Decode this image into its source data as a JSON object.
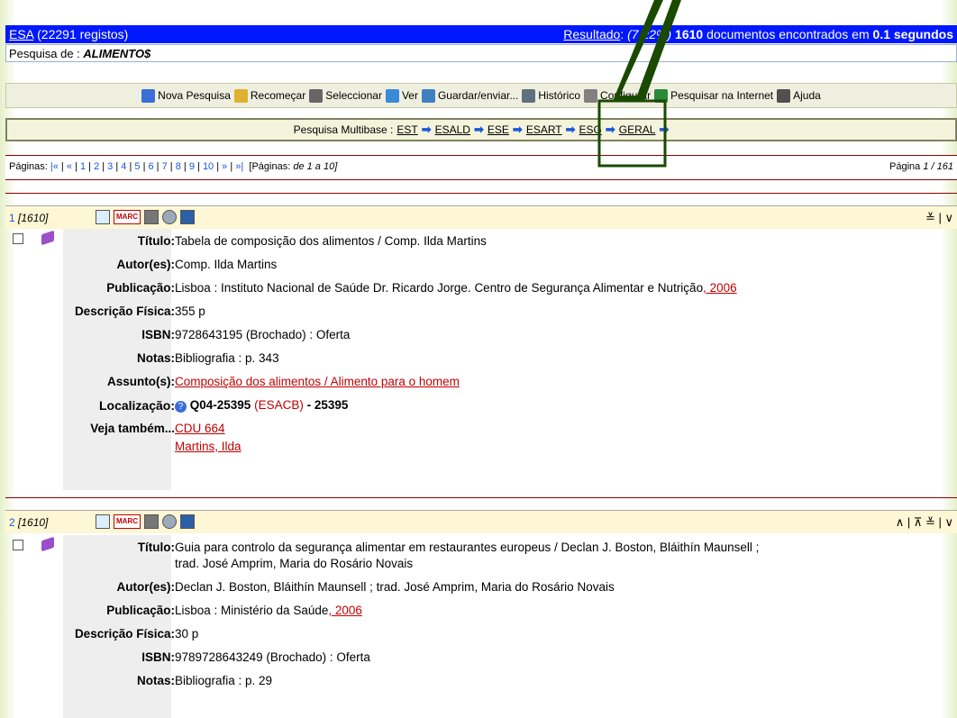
{
  "header": {
    "db_name": "ESA",
    "db_count": "(22291 registos)",
    "result_label": "Resultado",
    "result_pct": "(7.22%)",
    "result_count": "1610",
    "result_text": "documentos encontrados em",
    "result_time": "0.1 segundos"
  },
  "query": {
    "label": "Pesquisa de :",
    "term": "ALIMENTO$"
  },
  "toolbar": {
    "items": [
      {
        "label": "Nova Pesquisa",
        "icon": "magnifier-icon",
        "color": "#3a6fd8"
      },
      {
        "label": "Recomeçar",
        "icon": "home-icon",
        "color": "#e0b030"
      },
      {
        "label": "Seleccionar",
        "icon": "grid-icon",
        "color": "#666666"
      },
      {
        "label": "Ver",
        "icon": "view-icon",
        "color": "#3a8ad8"
      },
      {
        "label": "Guardar/enviar...",
        "icon": "save-icon",
        "color": "#4080c0"
      },
      {
        "label": "Histórico",
        "icon": "history-icon",
        "color": "#607080"
      },
      {
        "label": "Configurar",
        "icon": "configure-icon",
        "color": "#808080"
      },
      {
        "label": "Pesquisar na Internet",
        "icon": "globe-icon",
        "color": "#2a8a3a"
      },
      {
        "label": "Ajuda",
        "icon": "help-icon",
        "color": "#505050"
      }
    ]
  },
  "multibase": {
    "label": "Pesquisa Multibase :",
    "bases": [
      "EST",
      "ESALD",
      "ESE",
      "ESART",
      "ESG",
      "GERAL"
    ]
  },
  "pagination": {
    "label": "Páginas:",
    "first": "|«",
    "prev": "«",
    "pages": [
      "1",
      "2",
      "3",
      "4",
      "5",
      "6",
      "7",
      "8",
      "9",
      "10"
    ],
    "next": "»",
    "last": "»|",
    "range_label": "[Páginas:",
    "range": "de 1 a 10]",
    "page_label": "Página",
    "page_value": "1 / 161"
  },
  "records": [
    {
      "index": "1",
      "total": "[1610]",
      "nav": "≚ | ∨",
      "titulo_label": "Título:",
      "titulo": "Tabela de composição dos alimentos / Comp. Ilda Martins",
      "autor_label": "Autor(es):",
      "autor": "Comp. Ilda Martins",
      "pub_label": "Publicação:",
      "pub": "Lisboa : Instituto Nacional de Saúde Dr. Ricardo Jorge. Centro de Segurança Alimentar e Nutrição",
      "pub_year": ", 2006",
      "desc_label": "Descrição Física:",
      "desc": "355 p",
      "isbn_label": "ISBN:",
      "isbn": "9728643195 (Brochado) : Oferta",
      "notas_label": "Notas:",
      "notas": "Bibliografia : p. 343",
      "assunto_label": "Assunto(s):",
      "assunto1": "Composição dos alimentos",
      "assunto2": " / Alimento para o homem",
      "loc_label": "Localização:",
      "loc_code": "Q04-25395",
      "loc_lib": "(ESACB)",
      "loc_num": "- 25395",
      "veja_label": "Veja também...",
      "veja1": "CDU 664",
      "veja2": "Martins, Ilda"
    },
    {
      "index": "2",
      "total": "[1610]",
      "nav": "∧ | ⊼ ≚ | ∨",
      "titulo_label": "Título:",
      "titulo": "Guia para controlo da segurança alimentar em restaurantes europeus / Declan J. Boston, Bláithín Maunsell ;",
      "titulo2": "trad. José Amprim, Maria do Rosário Novais",
      "autor_label": "Autor(es):",
      "autor": "Declan J. Boston, Bláithín Maunsell ; trad. José Amprim, Maria do Rosário Novais",
      "pub_label": "Publicação:",
      "pub": "Lisboa : Ministério da Saúde",
      "pub_year": ", 2006",
      "desc_label": "Descrição Física:",
      "desc": "30 p",
      "isbn_label": "ISBN:",
      "isbn": "9789728643249 (Brochado) : Oferta",
      "notas_label": "Notas:",
      "notas": "Bibliografia : p. 29"
    }
  ],
  "record_icons": {
    "marc": "MARC"
  },
  "colors": {
    "header_bg": "#0018ff",
    "link": "#c00000",
    "accent": "#1a58d8",
    "annotation": "#1a4a00"
  }
}
